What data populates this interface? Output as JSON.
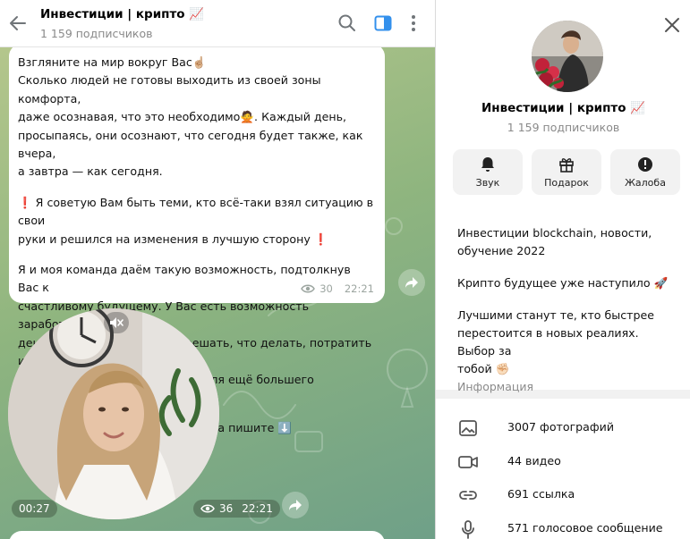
{
  "header": {
    "title": "Инвестиции | крипто 📈",
    "subscribers": "1 159 подписчиков"
  },
  "message": {
    "paragraphs": [
      [
        "Взгляните на мир вокруг Вас☝🏼",
        "Сколько людей не готовы выходить из своей зоны комфорта,",
        "даже осознавая, что это необходимо🙅. Каждый день,",
        "просыпаясь, они осознают, что сегодня будет также, как вчера,",
        "а завтра — как сегодня."
      ],
      [
        "❗ Я советую Вам быть теми, кто всё-таки взял ситуацию в свои",
        "руки и решился на изменения в лучшую сторону ❗"
      ],
      [
        "Я и моя команда даём такую возможность, подтолкнув Вас к",
        "счастливому будущему. У Вас есть  возможность заработать",
        "деньги💰, а далее уже Вам решать, что делать, потратить их в",
        "первый же день или вложить, для ещё большего заработка"
      ],
      [
        "По всем вопросам сотрудничества пишите ⬇️"
      ]
    ],
    "views": "30",
    "time": "22:21"
  },
  "video_message": {
    "duration": "00:27",
    "views": "36",
    "time": "22:21"
  },
  "panel": {
    "title": "Инвестиции | крипто 📈",
    "subscribers": "1 159 подписчиков",
    "actions": [
      {
        "label": "Звук",
        "icon": "bell-icon"
      },
      {
        "label": "Подарок",
        "icon": "gift-icon"
      },
      {
        "label": "Жалоба",
        "icon": "report-icon"
      }
    ],
    "description": [
      [
        "Инвестиции blockchain, новости,",
        "обучение 2022"
      ],
      [
        "Крипто будущее уже наступило 🚀"
      ],
      [
        "Лучшими станут те, кто быстрее",
        "перестоится в новых реалиях. Выбор за",
        "тобой ✊🏻"
      ]
    ],
    "info_label": "Информация",
    "media": [
      {
        "label": "3007 фотографий",
        "icon": "photo-icon"
      },
      {
        "label": "44 видео",
        "icon": "video-icon"
      },
      {
        "label": "691 ссылка",
        "icon": "link-icon"
      },
      {
        "label": "571 голосовое сообщение",
        "icon": "microphone-icon"
      }
    ]
  },
  "colors": {
    "accent": "#3390ec",
    "chat_bg": "#8fb57f",
    "panel_bg": "#f1f1f1"
  }
}
